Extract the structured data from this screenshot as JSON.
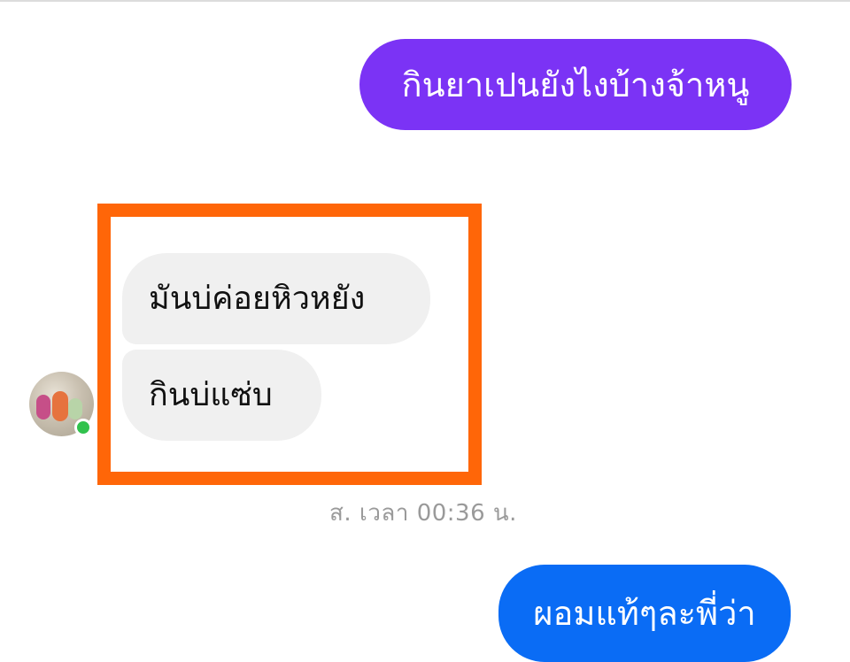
{
  "conversation": {
    "messages": [
      {
        "direction": "outgoing",
        "text": "กินยาเปนยังไงบ้างจ้าหนู"
      },
      {
        "direction": "incoming",
        "text": "มันบ่ค่อยหิวหยัง"
      },
      {
        "direction": "incoming",
        "text": "กินบ่แซ่บ"
      },
      {
        "direction": "outgoing",
        "text": "ผอมแท้ๆละพี่ว่า"
      }
    ],
    "timestamp": "ส. เวลา 00:36 น."
  },
  "colors": {
    "outgoing_purple": "#7b33f5",
    "outgoing_blue": "#0a6cf5",
    "incoming_bubble": "#f0f0f0",
    "highlight_border": "#ff6608",
    "online_indicator": "#31c24d",
    "timestamp_text": "#9a9a9a"
  },
  "icons": {
    "avatar": "contact-avatar",
    "status": "online-status-dot"
  }
}
